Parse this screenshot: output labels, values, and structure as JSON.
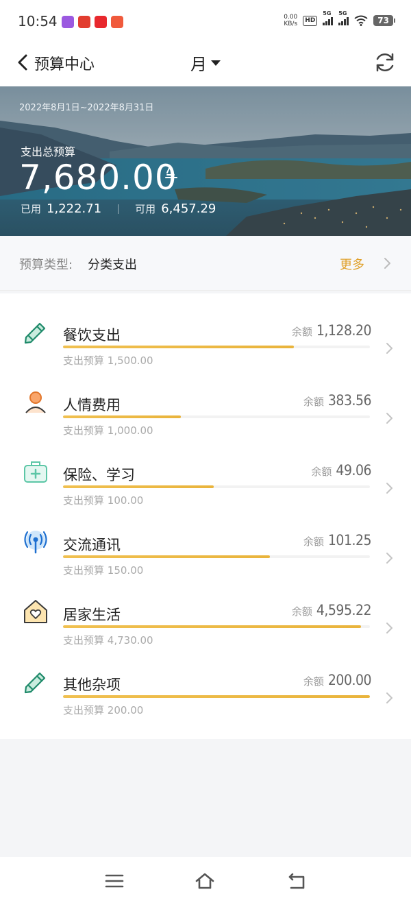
{
  "status_bar": {
    "time": "10:54",
    "net_speed": "0.00",
    "net_unit": "KB/s",
    "hd_label": "HD",
    "signal_1": "5G",
    "signal_2": "5G",
    "battery": "73"
  },
  "header": {
    "title": "预算中心",
    "period": "月",
    "back_icon": "chevron-left-icon",
    "refresh_icon": "refresh-icon"
  },
  "summary": {
    "date_range": "2022年8月1日~2022年8月31日",
    "total_label": "支出总预算",
    "total_amount": "7,680.00",
    "used_label": "已用",
    "used_amount": "1,222.71",
    "available_label": "可用",
    "available_amount": "6,457.29"
  },
  "budget_type": {
    "label": "预算类型:",
    "value": "分类支出",
    "more": "更多"
  },
  "colors": {
    "accent": "#e0a12c",
    "progress": "#edb840"
  },
  "budgets": [
    {
      "name": "餐饮支出",
      "icon": "pencil-icon",
      "remain_label": "余额",
      "remain": "1,128.20",
      "budget_label": "支出预算",
      "budget": "1,500.00",
      "progress": 0.752
    },
    {
      "name": "人情费用",
      "icon": "person-icon",
      "remain_label": "余额",
      "remain": "383.56",
      "budget_label": "支出预算",
      "budget": "1,000.00",
      "progress": 0.384
    },
    {
      "name": "保险、学习",
      "icon": "medical-kit-icon",
      "remain_label": "余额",
      "remain": "49.06",
      "budget_label": "支出预算",
      "budget": "100.00",
      "progress": 0.491
    },
    {
      "name": "交流通讯",
      "icon": "antenna-icon",
      "remain_label": "余额",
      "remain": "101.25",
      "budget_label": "支出预算",
      "budget": "150.00",
      "progress": 0.675
    },
    {
      "name": "居家生活",
      "icon": "home-heart-icon",
      "remain_label": "余额",
      "remain": "4,595.22",
      "budget_label": "支出预算",
      "budget": "4,730.00",
      "progress": 0.971
    },
    {
      "name": "其他杂项",
      "icon": "pencil-icon",
      "remain_label": "余额",
      "remain": "200.00",
      "budget_label": "支出预算",
      "budget": "200.00",
      "progress": 1.0
    }
  ],
  "nav": {
    "menu_icon": "menu-icon",
    "home_icon": "home-icon",
    "back_icon": "back-icon"
  }
}
